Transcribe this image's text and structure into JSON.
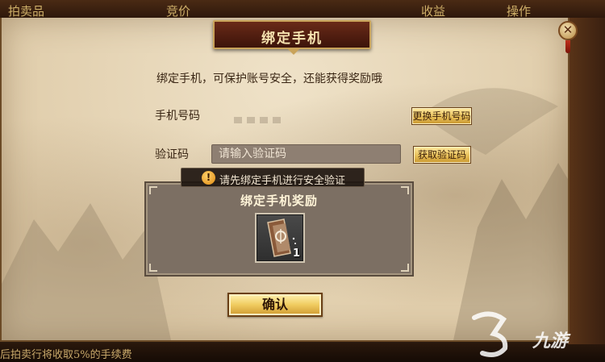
{
  "background": {
    "columns": [
      "拍卖品",
      "竞价",
      "收益",
      "操作"
    ],
    "footer_text": "后拍卖行将收取5%的手续费"
  },
  "dialog": {
    "title": "绑定手机",
    "intro": "绑定手机，可保护账号安全，还能获得奖励哦",
    "close_symbol": "✕",
    "phone_label": "手机号码",
    "change_phone_button": "更换手机号码",
    "code_label": "验证码",
    "code_placeholder": "请输入验证码",
    "get_code_button": "获取验证码",
    "toast": "请先绑定手机进行安全验证",
    "toast_icon_symbol": "!",
    "reward_title": "绑定手机奖励",
    "reward_item": {
      "icon": "card-item-icon",
      "count": "1"
    },
    "confirm_button": "确认"
  },
  "watermark": {
    "text": "九游"
  },
  "colors": {
    "parchment": "#e6d5b5",
    "gold_button": "#e8c05a",
    "dark_red_title": "#5a2014",
    "reward_panel": "#7c6f63"
  }
}
